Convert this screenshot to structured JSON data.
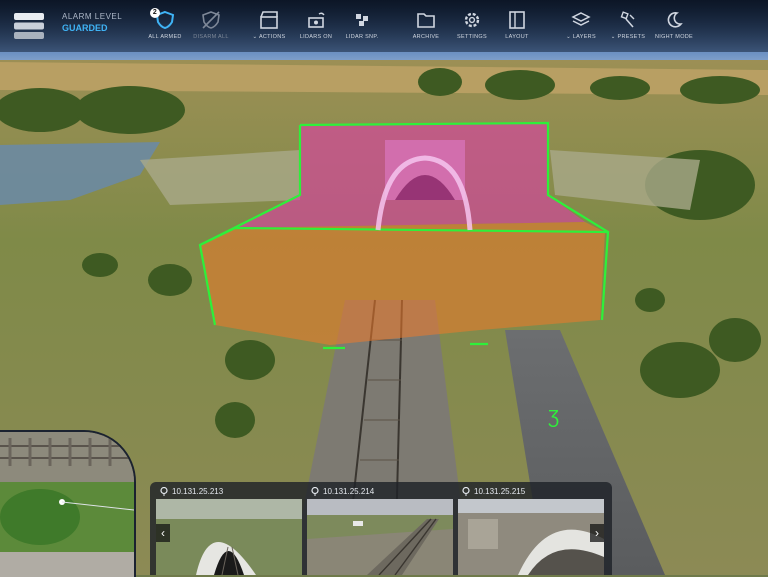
{
  "alarm": {
    "label": "ALARM LEVEL",
    "value": "GUARDED"
  },
  "toolbar": [
    {
      "label": "ALL ARMED",
      "badge": "2",
      "icon": "shield-icon"
    },
    {
      "label": "DISARM ALL",
      "icon": "shield-off-icon"
    },
    {
      "label": "ACTIONS",
      "icon": "clapperboard-icon",
      "dropdown": true
    },
    {
      "label": "LIDARS ON",
      "icon": "lidar-icon"
    },
    {
      "label": "LIDAR SNP.",
      "icon": "lidar-snapshot-icon"
    },
    {
      "label": "ARCHIVE",
      "icon": "folder-icon"
    },
    {
      "label": "SETTINGS",
      "icon": "gear-icon"
    },
    {
      "label": "LAYOUT",
      "icon": "layout-icon"
    },
    {
      "label": "LAYERS",
      "icon": "layers-icon",
      "dropdown": true
    },
    {
      "label": "PRESETS",
      "icon": "presets-icon",
      "dropdown": true
    },
    {
      "label": "NIGHT MODE",
      "icon": "moon-icon"
    }
  ],
  "cameras": [
    {
      "ip": "10.131.25.213"
    },
    {
      "ip": "10.131.25.214"
    },
    {
      "ip": "10.131.25.215"
    }
  ],
  "colors": {
    "accent": "#3fb3f5",
    "zone_outline": "#2ef03a",
    "zone_upper": "#e03ca8",
    "zone_lower": "#f07a2a"
  }
}
